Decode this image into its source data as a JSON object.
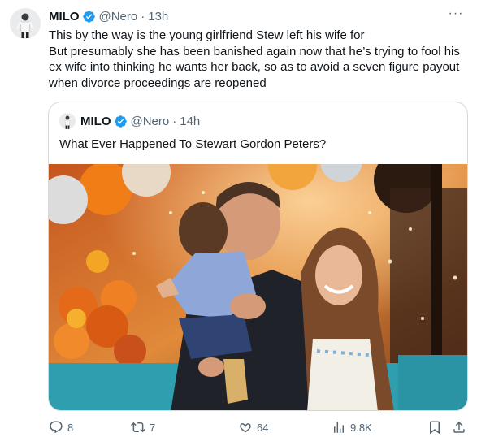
{
  "tweet": {
    "author_name": "MILO",
    "handle": "@Nero",
    "separator": "·",
    "time": "13h",
    "more_label": "···",
    "body_lines": [
      "This by the way is the young girlfriend Stew left his wife for",
      "But presumably she has been banished again now that he’s trying to fool his ex wife into thinking he wants her back, so as to avoid a seven figure payout when divorce proceedings are reopened"
    ]
  },
  "quoted": {
    "author_name": "MILO",
    "handle": "@Nero",
    "separator": "·",
    "time": "14h",
    "text": "What Ever Happened To Stewart Gordon Peters?"
  },
  "actions": {
    "replies": "8",
    "retweets": "7",
    "likes": "64",
    "views": "9.8K"
  },
  "icons": {
    "verified": "verified-badge-icon",
    "reply": "reply-icon",
    "retweet": "retweet-icon",
    "like": "heart-icon",
    "views": "views-chart-icon",
    "bookmark": "bookmark-icon",
    "share": "share-icon"
  },
  "colors": {
    "text_primary": "#0f1419",
    "text_secondary": "#536471",
    "verified_blue": "#1d9bf0",
    "border": "#cfd9de"
  }
}
